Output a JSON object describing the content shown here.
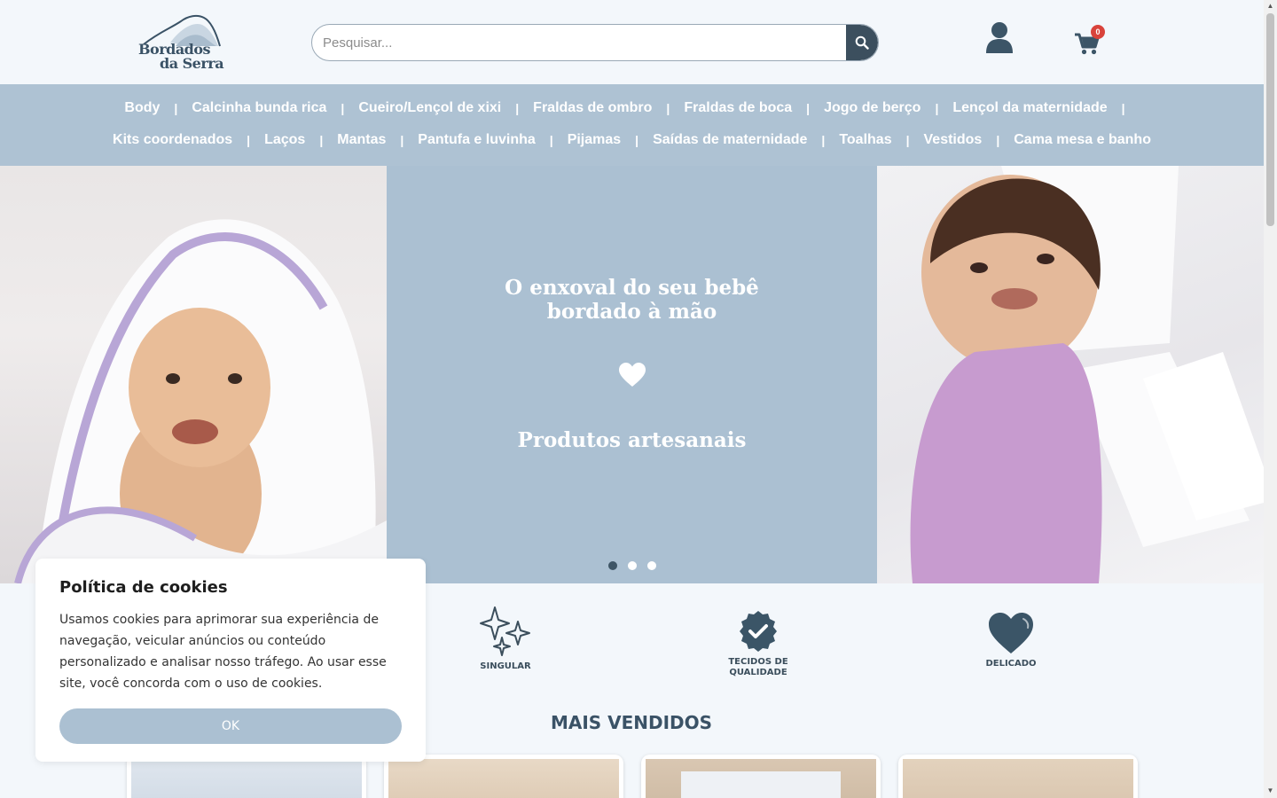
{
  "header": {
    "logo_line1": "Bordados",
    "logo_line2": "da Serra",
    "search_placeholder": "Pesquisar...",
    "cart_count": "0"
  },
  "nav": {
    "row1": [
      "Body",
      "Calcinha bunda rica",
      "Cueiro/Lençol de xixi",
      "Fraldas de ombro",
      "Fraldas de boca",
      "Jogo de berço",
      "Lençol da maternidade"
    ],
    "row2": [
      "Kits coordenados",
      "Laços",
      "Mantas",
      "Pantufa e luvinha",
      "Pijamas",
      "Saídas de maternidade",
      "Toalhas",
      "Vestidos",
      "Cama mesa e banho"
    ],
    "separator": "|"
  },
  "hero": {
    "title_line1": "O enxoval do seu bebê",
    "title_line2": "bordado à mão",
    "subtitle": "Produtos artesanais",
    "slides": 3,
    "active_slide": 1
  },
  "features": [
    {
      "label": "SINGULAR",
      "icon": "sparkles-icon"
    },
    {
      "label_line1": "TECIDOS DE",
      "label_line2": "QUALIDADE",
      "icon": "verified-badge-icon"
    },
    {
      "label": "DELICADO",
      "icon": "heart-icon"
    }
  ],
  "section": {
    "title": "MAIS VENDIDOS"
  },
  "cookie": {
    "title": "Política de cookies",
    "text": "Usamos cookies para aprimorar sua experiência de navegação, veicular anúncios ou conteúdo personalizado e analisar nosso tráfego. Ao usar esse site, você concorda com o uso de cookies.",
    "ok_label": "OK"
  },
  "colors": {
    "nav_bg": "#aec2d3",
    "accent_dark": "#3a5266",
    "badge_red": "#d9433b"
  }
}
